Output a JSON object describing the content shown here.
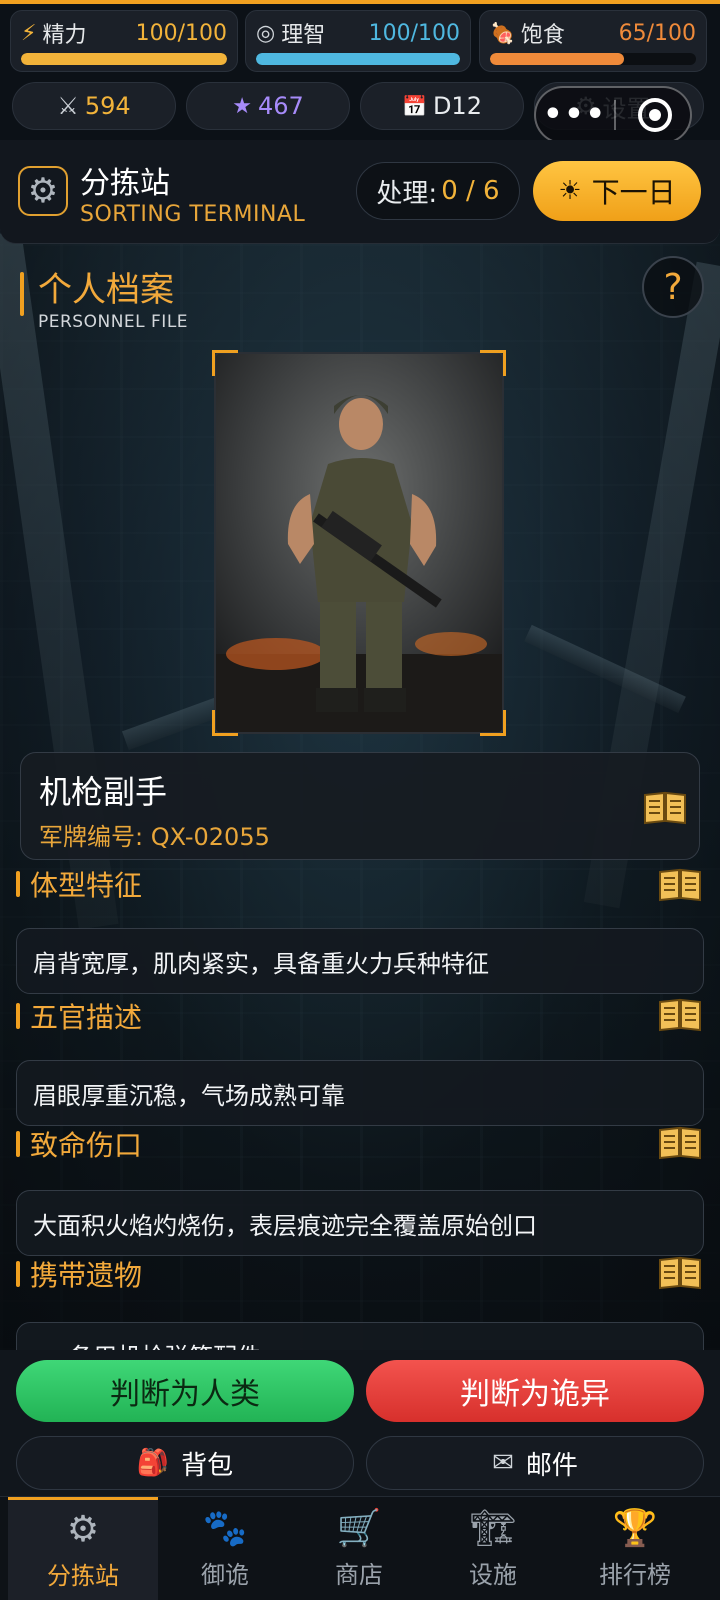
{
  "stats": [
    {
      "icon": "lightning-icon",
      "glyph": "⚡",
      "label": "精力",
      "value": "100/100",
      "color": "#f2b33a",
      "fill": 1.0
    },
    {
      "icon": "target-icon",
      "glyph": "◎",
      "label": "理智",
      "value": "100/100",
      "color": "#4fb8e0",
      "fill": 1.0
    },
    {
      "icon": "meat-icon",
      "glyph": "🍖",
      "label": "饱食",
      "value": "65/100",
      "color": "#ef8a3a",
      "fill": 0.65
    }
  ],
  "resources": {
    "swords": "594",
    "stars": "467",
    "day": "D12",
    "settings": "设置"
  },
  "header": {
    "title": "分拣站",
    "subtitle": "SORTING TERMINAL",
    "process_label": "处理:",
    "process_value": "0 / 6",
    "next_day": "下一日"
  },
  "section": {
    "title": "个人档案",
    "subtitle": "PERSONNEL FILE",
    "help": "?"
  },
  "card": {
    "name": "机枪副手",
    "tag": "军牌编号: QX-02055"
  },
  "attributes": [
    {
      "label": "体型特征",
      "text": "肩背宽厚，肌肉紧实，具备重火力兵种特征"
    },
    {
      "label": "五官描述",
      "text": "眉眼厚重沉稳，气场成熟可靠"
    },
    {
      "label": "致命伤口",
      "text": "大面积火焰灼烧伤，表层痕迹完全覆盖原始创口"
    },
    {
      "label": "携带遗物",
      "text": "备用机枪弹箱配件"
    }
  ],
  "actions": {
    "human": "判断为人类",
    "weird": "判断为诡异",
    "bag": "背包",
    "mail": "邮件"
  },
  "tabs": [
    {
      "label": "分拣站",
      "icon": "gear-icon",
      "glyph": "⚙"
    },
    {
      "label": "御诡",
      "icon": "paw-icon",
      "glyph": "🐾"
    },
    {
      "label": "商店",
      "icon": "cart-icon",
      "glyph": "🛒"
    },
    {
      "label": "设施",
      "icon": "crane-icon",
      "glyph": "🏗"
    },
    {
      "label": "排行榜",
      "icon": "trophy-icon",
      "glyph": "🏆"
    }
  ]
}
